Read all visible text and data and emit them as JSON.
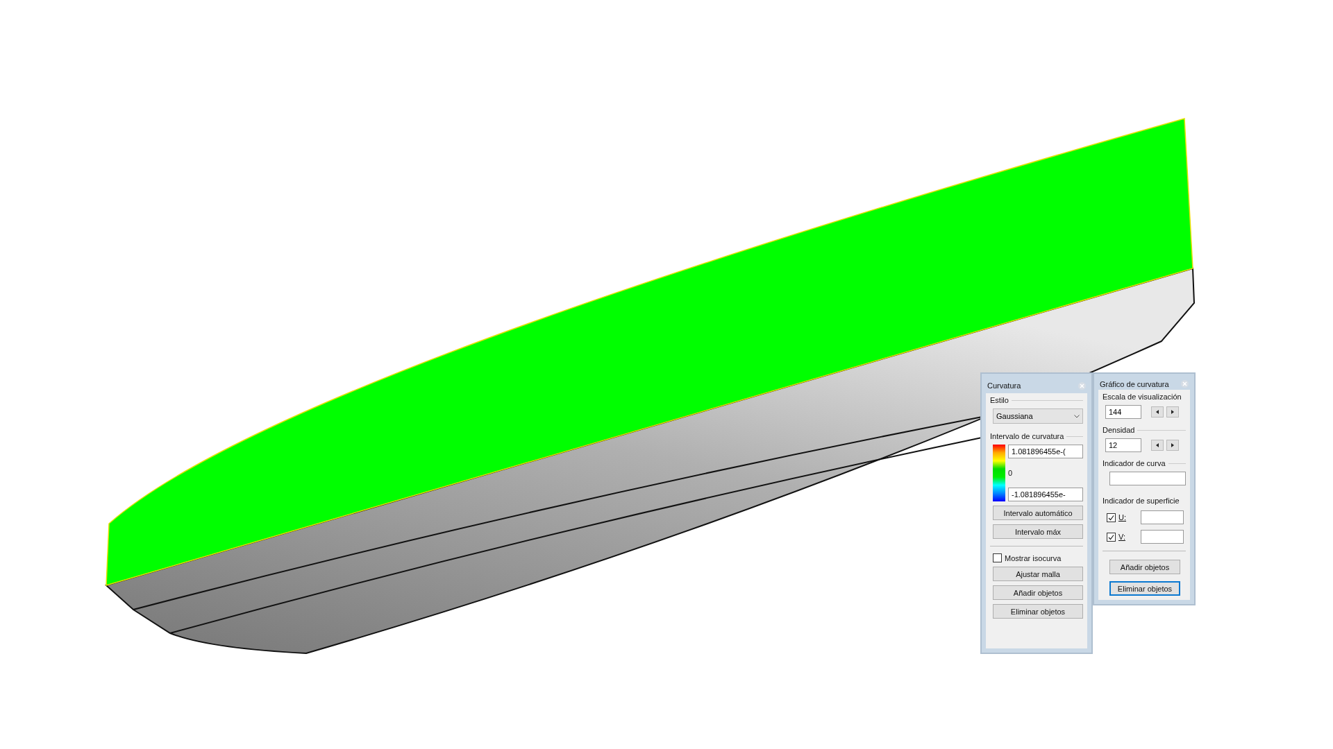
{
  "curvature_panel": {
    "title": "Curvatura",
    "style_label": "Estilo",
    "style_value": "Gaussiana",
    "interval_label": "Intervalo de curvatura",
    "max_value": "1.081896455e-(",
    "zero_label": "0",
    "min_value": "-1.081896455e-",
    "buttons": [
      {
        "label": "Intervalo automático",
        "focused": false
      },
      {
        "label": "Intervalo máx",
        "focused": false
      }
    ],
    "isocurve": {
      "label": "Mostrar isocurva",
      "checked": false
    },
    "bottom_buttons": [
      {
        "label": "Ajustar malla",
        "focused": false
      },
      {
        "label": "Añadir objetos",
        "focused": false
      },
      {
        "label": "Eliminar objetos",
        "focused": false
      }
    ]
  },
  "graph_panel": {
    "title": "Gráfico de curvatura",
    "scale_label": "Escala de visualización",
    "scale_value": "144",
    "density_label": "Densidad",
    "density_value": "12",
    "curve_label": "Indicador de curva",
    "surface_label": "Indicador de superficie",
    "surface_rows": [
      {
        "label": "U:",
        "checked": true
      },
      {
        "label": "V:",
        "checked": true
      }
    ],
    "buttons": [
      {
        "label": "Añadir objetos",
        "focused": false
      },
      {
        "label": "Eliminar objetos",
        "focused": true
      }
    ]
  }
}
